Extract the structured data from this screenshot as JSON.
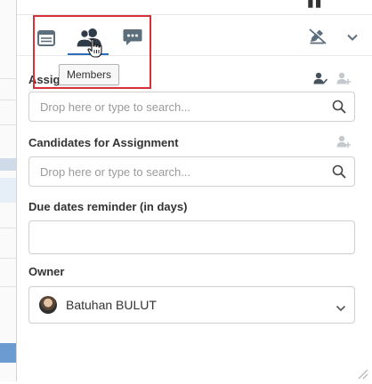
{
  "tabs": [
    {
      "id": "details",
      "icon": "list-details-icon",
      "active": false
    },
    {
      "id": "members",
      "icon": "members-icon",
      "active": true
    },
    {
      "id": "comments",
      "icon": "comment-icon",
      "active": false
    }
  ],
  "tooltip": {
    "text": "Members"
  },
  "header_actions": {
    "left_icon": "pen-slash-icon",
    "right_icon": "chevron-down-icon"
  },
  "assignees": {
    "label_visible": "Assig",
    "placeholder": "Drop here or type to search...",
    "icons": [
      "assign-to-me-icon",
      "add-user-icon"
    ]
  },
  "candidates": {
    "label": "Candidates for Assignment",
    "placeholder": "Drop here or type to search...",
    "icons": [
      "add-user-icon"
    ]
  },
  "due_dates": {
    "label": "Due dates reminder (in days)",
    "value": ""
  },
  "owner": {
    "label": "Owner",
    "selected": "Batuhan BULUT"
  },
  "colors": {
    "accent": "#2a6ebb",
    "highlight": "#d8303a",
    "icon": "#5d6f7d"
  }
}
